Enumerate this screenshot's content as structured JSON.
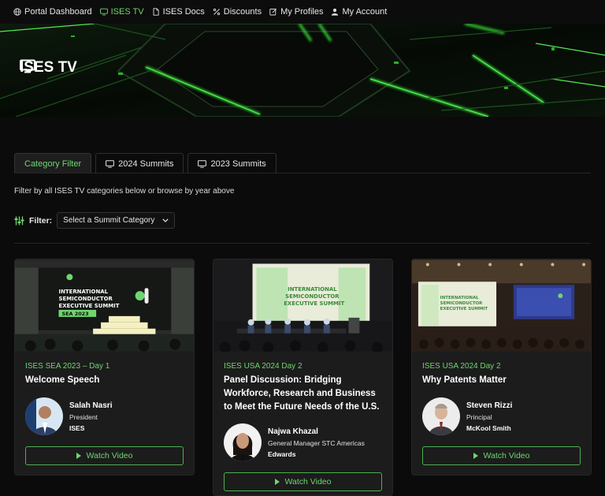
{
  "nav": [
    {
      "label": "Portal Dashboard",
      "icon": "globe-icon",
      "active": false
    },
    {
      "label": "ISES TV",
      "icon": "tv-icon",
      "active": true
    },
    {
      "label": "ISES Docs",
      "icon": "document-icon",
      "active": false
    },
    {
      "label": "Discounts",
      "icon": "percent-icon",
      "active": false
    },
    {
      "label": "My Profiles",
      "icon": "edit-icon",
      "active": false
    },
    {
      "label": "My Account",
      "icon": "user-icon",
      "active": false
    }
  ],
  "hero": {
    "title": "ISES TV"
  },
  "tabs": [
    {
      "label": "Category Filter",
      "active": true
    },
    {
      "label": "2024 Summits",
      "active": false
    },
    {
      "label": "2023 Summits",
      "active": false
    }
  ],
  "help_text": "Filter by all ISES TV categories below or browse by year above",
  "filter": {
    "label": "Filter:",
    "selected": "Select a Summit Category"
  },
  "watch_label": "Watch Video",
  "cards": [
    {
      "category": "ISES SEA 2023 – Day 1",
      "title": "Welcome Speech",
      "speaker": {
        "name": "Salah Nasri",
        "role": "President",
        "org": "ISES"
      },
      "thumb_text": [
        "INTERNATIONAL",
        "SEMICONDUCTOR",
        "EXECUTIVE SUMMIT",
        "SEA 2023"
      ]
    },
    {
      "category": "ISES USA 2024 Day 2",
      "title": "Panel Discussion: Bridging Workforce, Research and Business to Meet the Future Needs of the U.S.",
      "speaker": {
        "name": "Najwa Khazal",
        "role": "General Manager STC Americas",
        "org": "Edwards"
      },
      "thumb_text": [
        "INTERNATIONAL",
        "SEMICONDUCTOR",
        "EXECUTIVE SUMMIT"
      ]
    },
    {
      "category": "ISES USA 2024 Day 2",
      "title": "Why Patents Matter",
      "speaker": {
        "name": "Steven Rizzi",
        "role": "Principal",
        "org": "McKool Smith"
      },
      "thumb_text": [
        "INTERNATIONAL",
        "SEMICONDUCTOR",
        "EXECUTIVE SUMMIT"
      ]
    }
  ]
}
